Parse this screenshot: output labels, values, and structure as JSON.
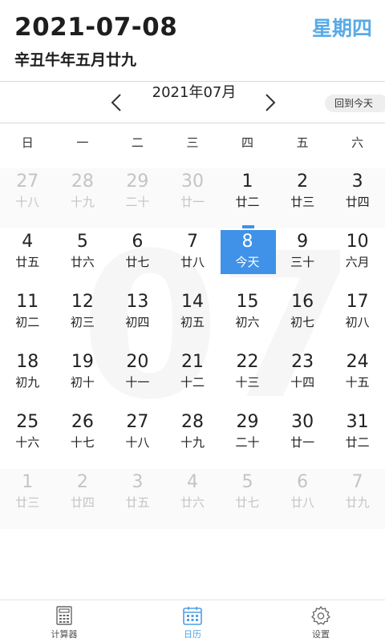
{
  "header": {
    "date": "2021-07-08",
    "weekday": "星期四",
    "lunar_date": "辛丑牛年五月廿九"
  },
  "nav": {
    "month_title": "2021年07月",
    "today_button": "回到今天"
  },
  "weekdays": [
    "日",
    "一",
    "二",
    "三",
    "四",
    "五",
    "六"
  ],
  "watermark": "07",
  "weeks": [
    [
      {
        "day": "27",
        "lunar": "十八",
        "other": true
      },
      {
        "day": "28",
        "lunar": "十九",
        "other": true
      },
      {
        "day": "29",
        "lunar": "二十",
        "other": true
      },
      {
        "day": "30",
        "lunar": "廿一",
        "other": true
      },
      {
        "day": "1",
        "lunar": "廿二"
      },
      {
        "day": "2",
        "lunar": "廿三"
      },
      {
        "day": "3",
        "lunar": "廿四"
      }
    ],
    [
      {
        "day": "4",
        "lunar": "廿五"
      },
      {
        "day": "5",
        "lunar": "廿六"
      },
      {
        "day": "6",
        "lunar": "廿七"
      },
      {
        "day": "7",
        "lunar": "廿八"
      },
      {
        "day": "8",
        "lunar": "今天",
        "today": true
      },
      {
        "day": "9",
        "lunar": "三十"
      },
      {
        "day": "10",
        "lunar": "六月"
      }
    ],
    [
      {
        "day": "11",
        "lunar": "初二"
      },
      {
        "day": "12",
        "lunar": "初三"
      },
      {
        "day": "13",
        "lunar": "初四"
      },
      {
        "day": "14",
        "lunar": "初五"
      },
      {
        "day": "15",
        "lunar": "初六"
      },
      {
        "day": "16",
        "lunar": "初七"
      },
      {
        "day": "17",
        "lunar": "初八"
      }
    ],
    [
      {
        "day": "18",
        "lunar": "初九"
      },
      {
        "day": "19",
        "lunar": "初十"
      },
      {
        "day": "20",
        "lunar": "十一"
      },
      {
        "day": "21",
        "lunar": "十二"
      },
      {
        "day": "22",
        "lunar": "十三"
      },
      {
        "day": "23",
        "lunar": "十四"
      },
      {
        "day": "24",
        "lunar": "十五"
      }
    ],
    [
      {
        "day": "25",
        "lunar": "十六"
      },
      {
        "day": "26",
        "lunar": "十七"
      },
      {
        "day": "27",
        "lunar": "十八"
      },
      {
        "day": "28",
        "lunar": "十九"
      },
      {
        "day": "29",
        "lunar": "二十"
      },
      {
        "day": "30",
        "lunar": "廿一"
      },
      {
        "day": "31",
        "lunar": "廿二"
      }
    ],
    [
      {
        "day": "1",
        "lunar": "廿三",
        "other": true
      },
      {
        "day": "2",
        "lunar": "廿四",
        "other": true
      },
      {
        "day": "3",
        "lunar": "廿五",
        "other": true
      },
      {
        "day": "4",
        "lunar": "廿六",
        "other": true
      },
      {
        "day": "5",
        "lunar": "廿七",
        "other": true
      },
      {
        "day": "6",
        "lunar": "廿八",
        "other": true
      },
      {
        "day": "7",
        "lunar": "廿九",
        "other": true
      }
    ]
  ],
  "tabs": [
    {
      "label": "计算器",
      "icon": "calculator-icon"
    },
    {
      "label": "日历",
      "icon": "calendar-icon",
      "active": true
    },
    {
      "label": "设置",
      "icon": "gear-icon"
    }
  ],
  "colors": {
    "accent": "#3f92e8",
    "weekday_text": "#5aaae6"
  }
}
